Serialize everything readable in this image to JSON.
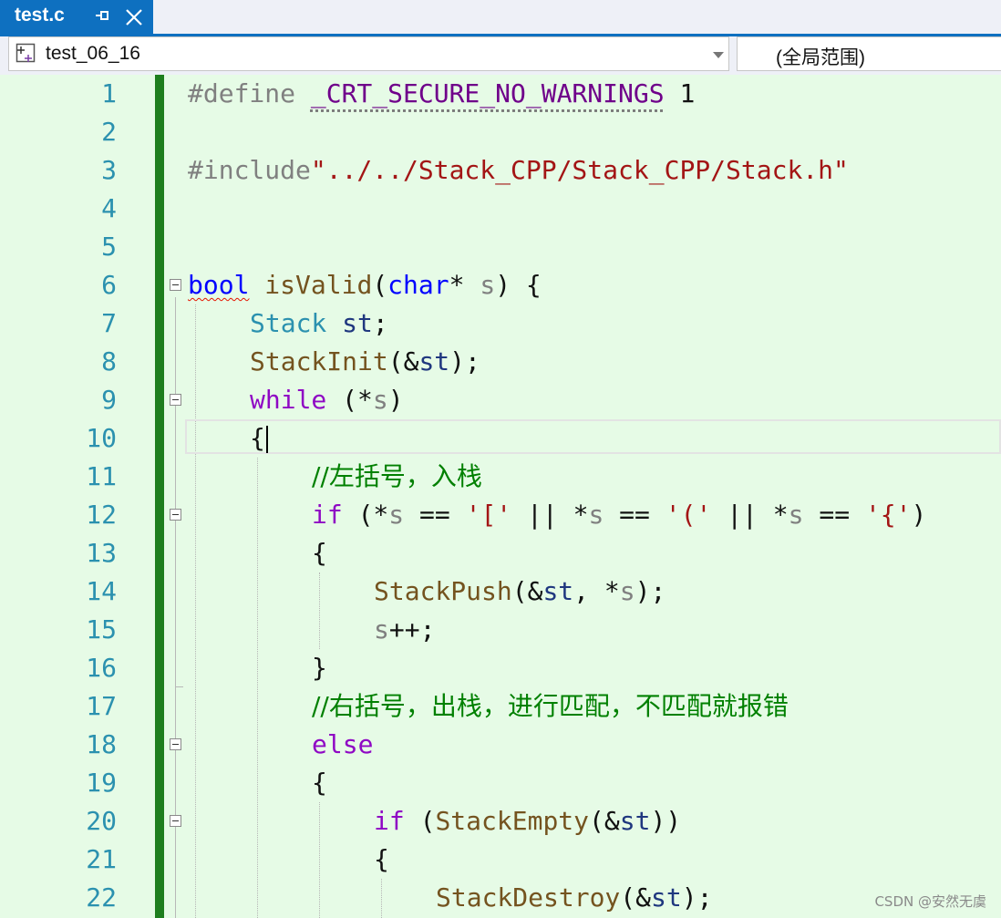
{
  "tab": {
    "title": "test.c"
  },
  "navbar": {
    "project": "test_06_16",
    "scope": "(全局范围)"
  },
  "line_numbers": [
    "1",
    "2",
    "3",
    "4",
    "5",
    "6",
    "7",
    "8",
    "9",
    "10",
    "11",
    "12",
    "13",
    "14",
    "15",
    "16",
    "17",
    "18",
    "19",
    "20",
    "21",
    "22"
  ],
  "code": {
    "l1_directive": "#define ",
    "l1_macro": "_CRT_SECURE_NO_WARNINGS",
    "l1_value": " 1",
    "l3_directive": "#include",
    "l3_path": "\"../../Stack_CPP/Stack_CPP/Stack.h\"",
    "l6_bool": "bool",
    "l6_fn": "isValid",
    "l6_paren": "(",
    "l6_char": "char",
    "l6_star": "* ",
    "l6_s": "s",
    "l6_end": ") {",
    "l7_type": "Stack",
    "l7_var": "st",
    "l7_end": ";",
    "l8_fn": "StackInit",
    "l8_open": "(&",
    "l8_var": "st",
    "l8_end": ");",
    "l9_kw": "while",
    "l9_open": " (*",
    "l9_s": "s",
    "l9_close": ")",
    "l10": "{",
    "l11": "//左括号，入栈",
    "l12_kw": "if",
    "l12_a": " (*",
    "l12_s1": "s",
    "l12_b": " == ",
    "l12_c1": "'['",
    "l12_c": " || *",
    "l12_s2": "s",
    "l12_d": " == ",
    "l12_c2": "'('",
    "l12_e": " || *",
    "l12_s3": "s",
    "l12_f": " == ",
    "l12_c3": "'{'",
    "l12_g": ")",
    "l13": "{",
    "l14_fn": "StackPush",
    "l14_open": "(&",
    "l14_var": "st",
    "l14_mid": ", *",
    "l14_s": "s",
    "l14_end": ");",
    "l15_s": "s",
    "l15_end": "++;",
    "l16": "}",
    "l17": "//右括号，出栈，进行匹配，不匹配就报错",
    "l18": "else",
    "l19": "{",
    "l20_kw": "if",
    "l20_open": " (",
    "l20_fn": "StackEmpty",
    "l20_amp": "(&",
    "l20_var": "st",
    "l20_end": "))",
    "l21": "{",
    "l22_fn": "StackDestroy",
    "l22_open": "(&",
    "l22_var": "st",
    "l22_end": ");"
  },
  "watermark": "CSDN @安然无虞",
  "colors": {
    "editor_bg": "#e6fbe6",
    "tab_active": "#0e70c0",
    "line_number": "#2b91af",
    "change_bar": "#1e7e1e",
    "keyword": "#0000ff",
    "control_keyword": "#8f08c4",
    "type": "#2b91af",
    "function": "#74531f",
    "string": "#a31515",
    "comment": "#008000"
  }
}
